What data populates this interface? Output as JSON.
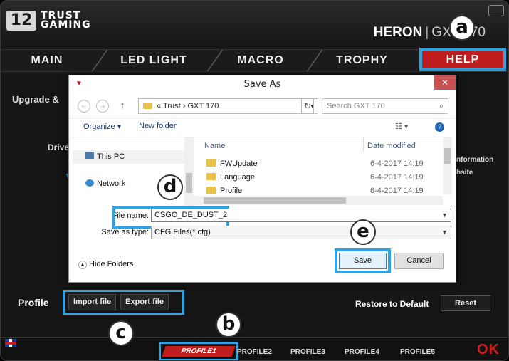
{
  "app": {
    "logo_box": "12",
    "logo_line1": "TRUST",
    "logo_line2": "GAMING",
    "product_name": "HERON",
    "product_sep": "|",
    "product_model": "GXT 170"
  },
  "nav": {
    "tabs": [
      "MAIN",
      "LED LIGHT",
      "MACRO",
      "TROPHY"
    ],
    "active_tab": "HELP"
  },
  "background": {
    "upgrade": "Upgrade &",
    "driver": "Drive",
    "info1": "nformation",
    "info2": "bsite",
    "v_letter": "V"
  },
  "dialog": {
    "title": "Save As",
    "close": "✕",
    "back": "←",
    "forward": "→",
    "up": "↑",
    "breadcrumb": [
      "«",
      "Trust",
      "›",
      "GXT 170"
    ],
    "refresh": "↻",
    "search_placeholder": "Search GXT 170",
    "organize": "Organize ▾",
    "new_folder": "New folder",
    "view": "☷ ▾",
    "help": "?",
    "nav_items": [
      "This PC",
      "Network"
    ],
    "col_name": "Name",
    "col_date": "Date modified",
    "files": [
      {
        "name": "FWUpdate",
        "date": "6-4-2017 14:19"
      },
      {
        "name": "Language",
        "date": "6-4-2017 14:19"
      },
      {
        "name": "Profile",
        "date": "6-4-2017 14:19"
      }
    ],
    "file_name_label": "File name:",
    "file_name_value": "CSGO_DE_DUST_2",
    "save_type_label": "Save as type:",
    "save_type_value": "CFG Files(*.cfg)",
    "hide_folders": "Hide Folders",
    "save": "Save",
    "cancel": "Cancel"
  },
  "profile": {
    "label": "Profile",
    "import": "Import file",
    "export": "Export file",
    "restore_label": "Restore to Default",
    "reset": "Reset"
  },
  "bottom": {
    "profiles": [
      "PROFILE1",
      "PROFILE2",
      "PROFILE3",
      "PROFILE4",
      "PROFILE5"
    ],
    "ok": "OK"
  },
  "callouts": {
    "a": "a",
    "b": "b",
    "c": "c",
    "d": "d",
    "e": "e"
  },
  "colors": {
    "accent_red": "#c01e1e",
    "highlight_blue": "#2fa3e0"
  }
}
